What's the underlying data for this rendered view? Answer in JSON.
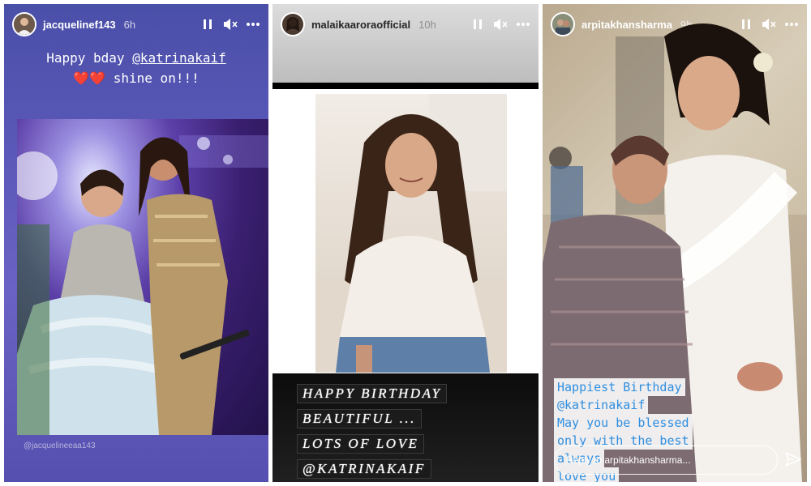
{
  "panels": [
    {
      "username": "jacquelinef143",
      "time": "6h",
      "caption_line1_prefix": "Happy bday ",
      "caption_mention": "@katrinakaif",
      "caption_line2_hearts": "❤️❤️",
      "caption_line2_text": " shine on!!!",
      "photo_credit": "@jacquelineeaa143"
    },
    {
      "username": "malaikaaroraofficial",
      "time": "10h",
      "lines": [
        "HAPPY BIRTHDAY",
        "BEAUTIFUL ...",
        "LOTS OF LOVE",
        "@KATRINAKAIF"
      ]
    },
    {
      "username": "arpitakhansharma",
      "time": "9h",
      "message_lines": [
        "Happiest Birthday",
        "@katrinakaif",
        "May you be blessed",
        "only with the best",
        "always",
        "love you"
      ],
      "reply_placeholder": "Reply to arpitakhansharma..."
    }
  ],
  "icons": {
    "pause": "pause-icon",
    "mute": "mute-icon",
    "more": "more-icon",
    "send": "send-icon"
  },
  "colors": {
    "panel1_bg": "#5a58b8",
    "panel3_text": "#2f8fe0"
  }
}
